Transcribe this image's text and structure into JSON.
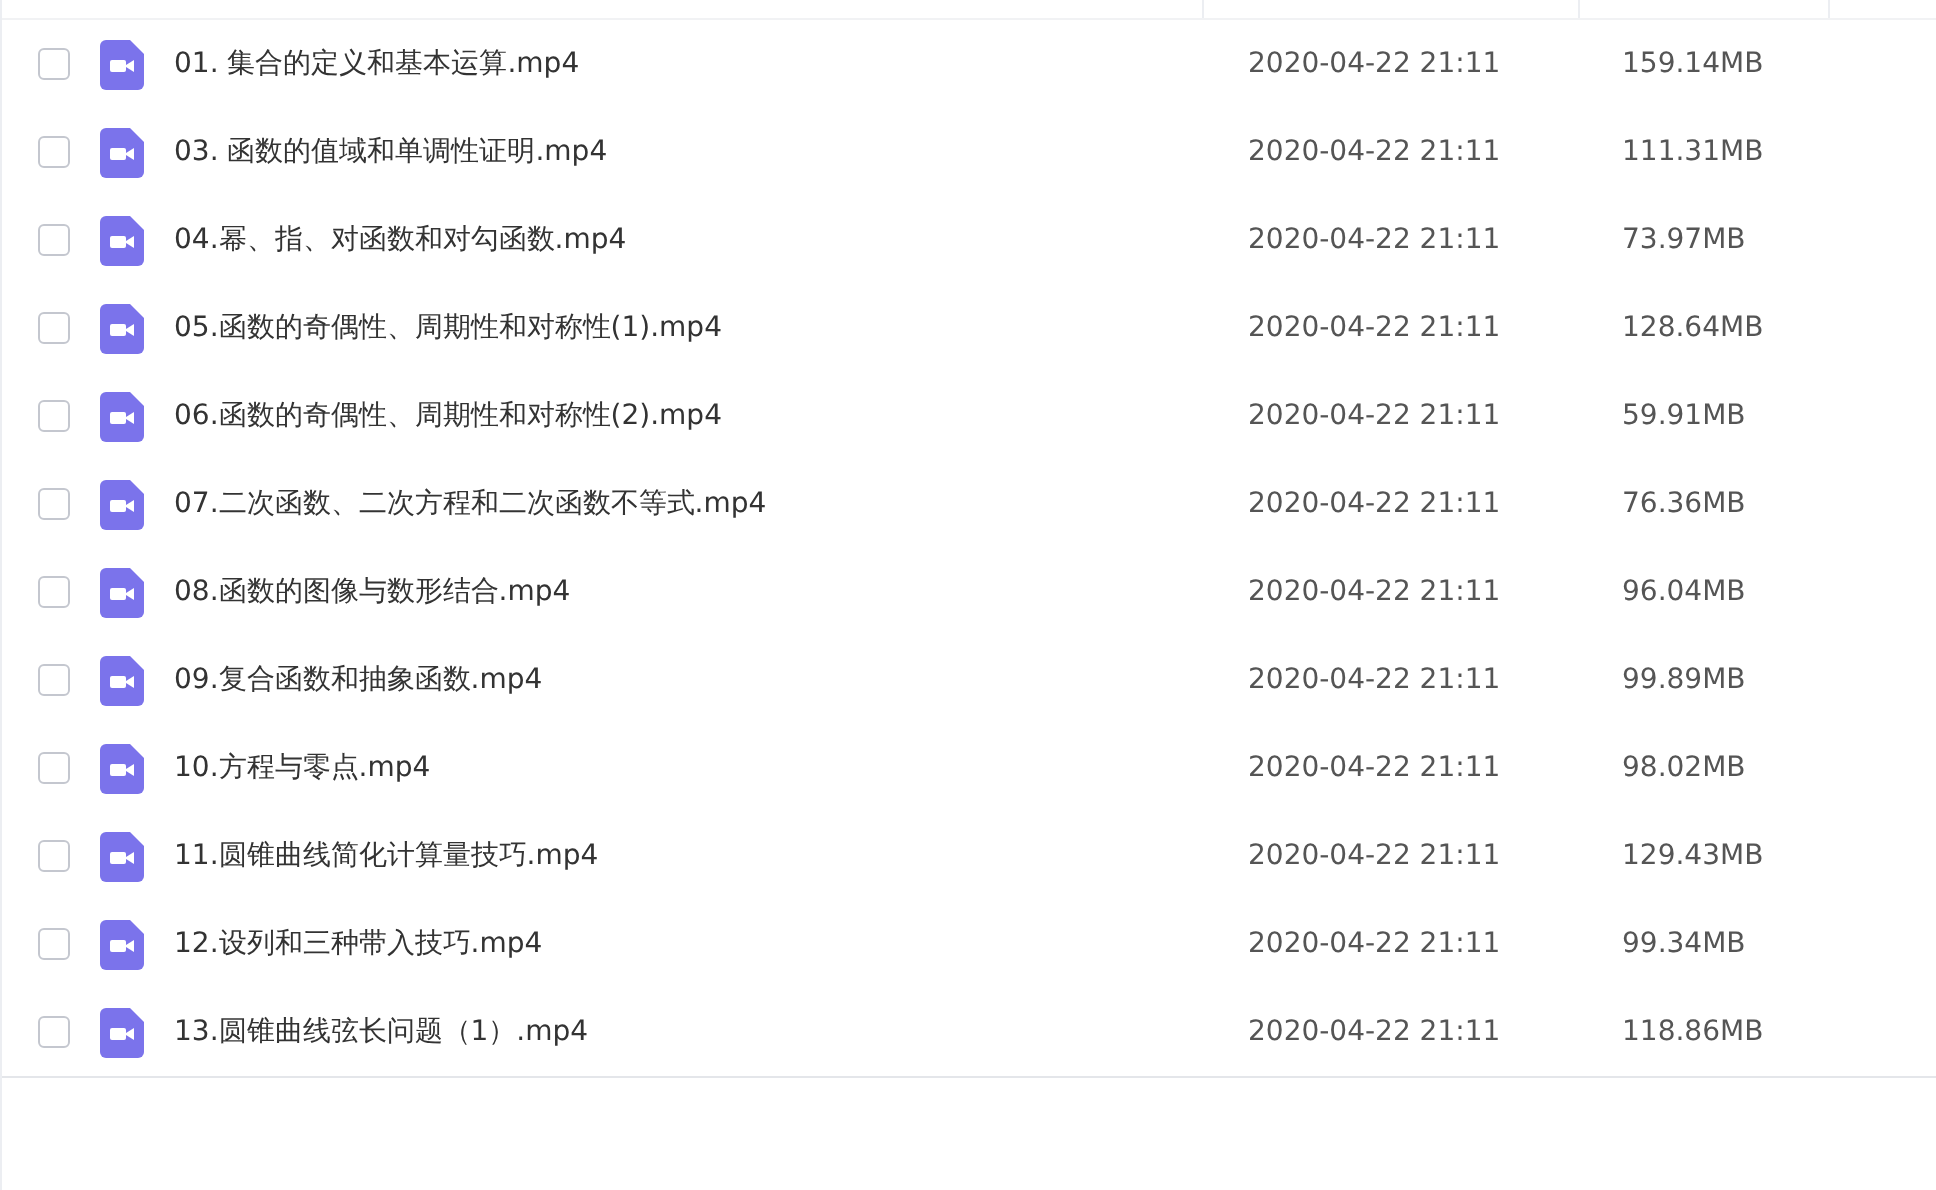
{
  "files": [
    {
      "name": "01. 集合的定义和基本运算.mp4",
      "date": "2020-04-22 21:11",
      "size": "159.14MB",
      "checked": false
    },
    {
      "name": "03. 函数的值域和单调性证明.mp4",
      "date": "2020-04-22 21:11",
      "size": "111.31MB",
      "checked": false
    },
    {
      "name": "04.幂、指、对函数和对勾函数.mp4",
      "date": "2020-04-22 21:11",
      "size": "73.97MB",
      "checked": false
    },
    {
      "name": "05.函数的奇偶性、周期性和对称性(1).mp4",
      "date": "2020-04-22 21:11",
      "size": "128.64MB",
      "checked": false
    },
    {
      "name": "06.函数的奇偶性、周期性和对称性(2).mp4",
      "date": "2020-04-22 21:11",
      "size": "59.91MB",
      "checked": false
    },
    {
      "name": "07.二次函数、二次方程和二次函数不等式.mp4",
      "date": "2020-04-22 21:11",
      "size": "76.36MB",
      "checked": false
    },
    {
      "name": "08.函数的图像与数形结合.mp4",
      "date": "2020-04-22 21:11",
      "size": "96.04MB",
      "checked": false
    },
    {
      "name": "09.复合函数和抽象函数.mp4",
      "date": "2020-04-22 21:11",
      "size": "99.89MB",
      "checked": false
    },
    {
      "name": "10.方程与零点.mp4",
      "date": "2020-04-22 21:11",
      "size": "98.02MB",
      "checked": false
    },
    {
      "name": "11.圆锥曲线简化计算量技巧.mp4",
      "date": "2020-04-22 21:11",
      "size": "129.43MB",
      "checked": false
    },
    {
      "name": "12.设列和三种带入技巧.mp4",
      "date": "2020-04-22 21:11",
      "size": "99.34MB",
      "checked": false
    },
    {
      "name": "13.圆锥曲线弦长问题（1）.mp4",
      "date": "2020-04-22 21:11",
      "size": "118.86MB",
      "checked": false
    }
  ]
}
